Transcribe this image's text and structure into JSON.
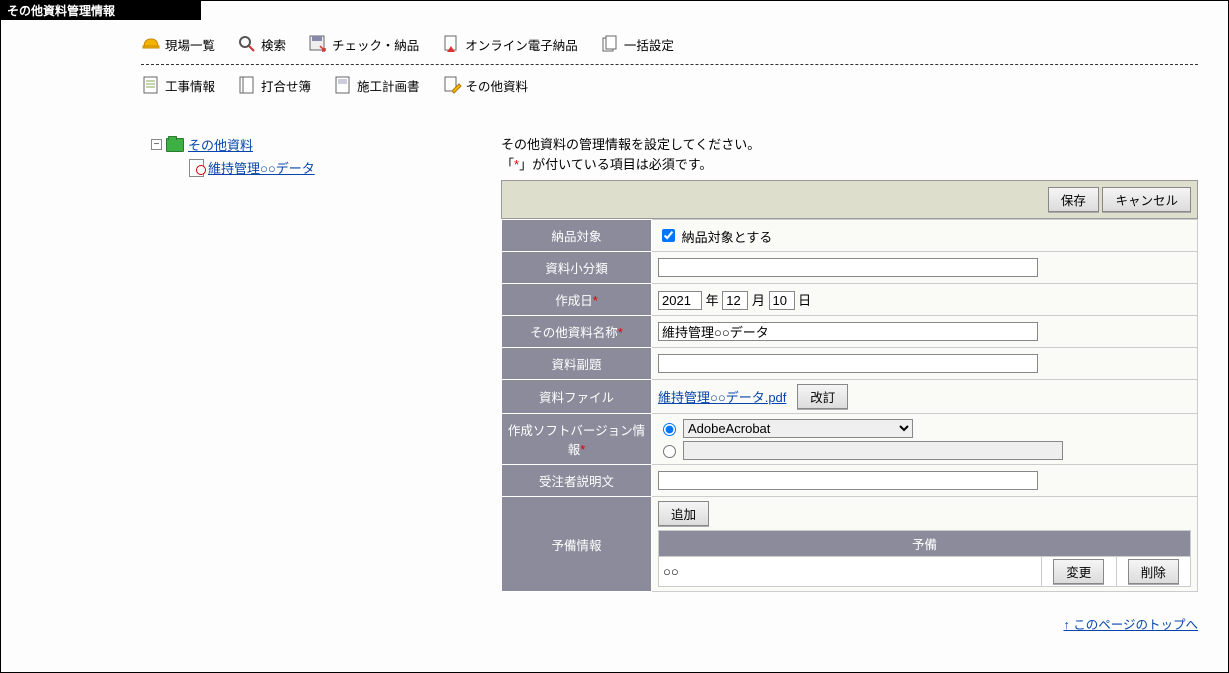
{
  "title": "その他資料管理情報",
  "toolbar_top": {
    "site_list": "現場一覧",
    "search": "検索",
    "check_noukin": "チェック・納品",
    "online_noukin": "オンライン電子納品",
    "batch_settings": "一括設定"
  },
  "toolbar_sub": {
    "kouji_info": "工事情報",
    "uchiawase": "打合せ簿",
    "sekou_plan": "施工計画書",
    "other_docs": "その他資料"
  },
  "tree": {
    "root": "その他資料",
    "child": "維持管理○○データ"
  },
  "form": {
    "instruction_line1": "その他資料の管理情報を設定してください。",
    "instruction_line2a": "「",
    "instruction_line2b": "*",
    "instruction_line2c": "」が付いている項目は必須です。",
    "save_label": "保存",
    "cancel_label": "キャンセル",
    "row_noukin_label": "納品対象",
    "row_noukin_check_label": "納品対象とする",
    "row_subclass_label": "資料小分類",
    "row_subclass_value": "",
    "row_date_label": "作成日",
    "date_year": "2021",
    "date_year_suffix": "年",
    "date_month": "12",
    "date_month_suffix": "月",
    "date_day": "10",
    "date_day_suffix": "日",
    "row_name_label": "その他資料名称",
    "row_name_value": "維持管理○○データ",
    "row_subtitle_label": "資料副題",
    "row_subtitle_value": "",
    "row_file_label": "資料ファイル",
    "row_file_link": "維持管理○○データ.pdf",
    "revise_btn": "改訂",
    "row_soft_label": "作成ソフトバージョン情報",
    "soft_select": "AdobeAcrobat",
    "soft_text": "",
    "row_explain_label": "受注者説明文",
    "row_explain_value": "",
    "row_reserve_label": "予備情報",
    "add_btn": "追加",
    "reserve_header": "予備",
    "reserve_value": "○○",
    "change_btn": "変更",
    "delete_btn": "削除"
  },
  "footer": {
    "to_top_arrow": "↑",
    "to_top": "このページのトップへ"
  }
}
